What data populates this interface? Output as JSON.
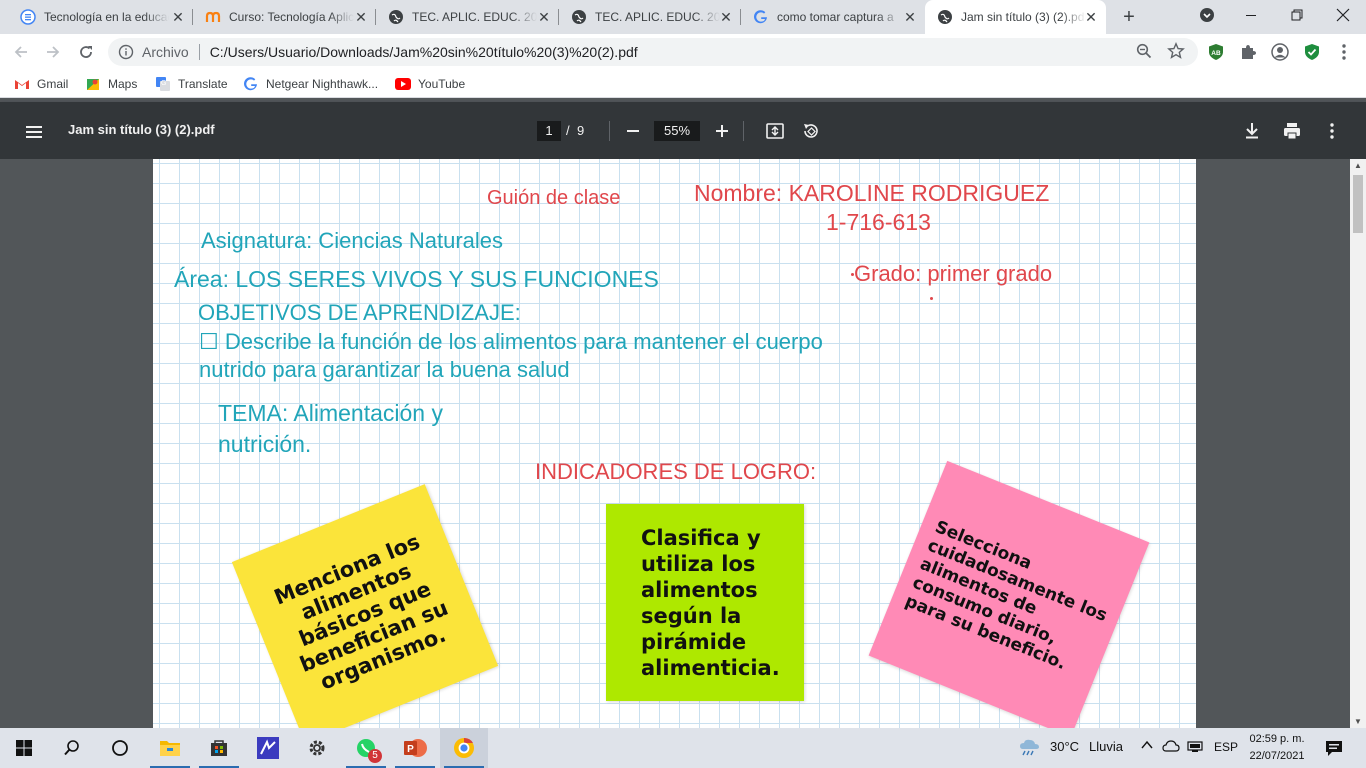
{
  "browser": {
    "tabs": [
      {
        "title": "Tecnología en la educación",
        "icon": "document-list-icon"
      },
      {
        "title": "Curso: Tecnología Aplicada",
        "icon": "moodle-icon"
      },
      {
        "title": "TEC. APLIC. EDUC. 2021",
        "icon": "globe-icon"
      },
      {
        "title": "TEC. APLIC. EDUC. 2021",
        "icon": "globe-icon"
      },
      {
        "title": "como tomar captura a",
        "icon": "google-icon"
      },
      {
        "title": "Jam sin título (3) (2).pdf",
        "icon": "globe-icon"
      }
    ],
    "scheme_label": "Archivo",
    "url": "C:/Users/Usuario/Downloads/Jam%20sin%20título%20(3)%20(2).pdf",
    "extension_ab": "AB"
  },
  "bookmarks": [
    {
      "label": "Gmail",
      "icon": "gmail-icon"
    },
    {
      "label": "Maps",
      "icon": "maps-icon"
    },
    {
      "label": "Translate",
      "icon": "translate-icon"
    },
    {
      "label": "Netgear Nighthawk...",
      "icon": "google-icon"
    },
    {
      "label": "YouTube",
      "icon": "youtube-icon"
    }
  ],
  "pdf": {
    "title": "Jam sin título (3) (2).pdf",
    "current_page": "1",
    "page_sep": "/",
    "total_pages": "9",
    "zoom": "55%"
  },
  "document": {
    "guion": "Guión de clase",
    "nombre": "Nombre: KAROLINE RODRIGUEZ",
    "id_number": "1-716-613",
    "asignatura": "Asignatura: Ciencias Naturales",
    "area": "Área: LOS SERES VIVOS Y SUS FUNCIONES",
    "grado": "Grado: primer grado",
    "objetivos_title": "OBJETIVOS DE APRENDIZAJE:",
    "objetivo_line1": "☐ Describe la función de los alimentos para mantener el cuerpo",
    "objetivo_line2": "nutrido para garantizar la buena salud",
    "tema_line1": "TEMA: Alimentación y",
    "tema_line2": "nutrición.",
    "indicadores": "INDICADORES DE LOGRO:",
    "notes": [
      {
        "lines": [
          "Menciona los",
          "alimentos",
          "básicos que",
          "benefician su",
          "organismo."
        ],
        "color": "#fbe43a"
      },
      {
        "lines": [
          "Clasifica y",
          "utiliza los",
          "alimentos",
          "según la",
          "pirámide",
          "alimenticia."
        ],
        "color": "#aee800"
      },
      {
        "lines": [
          "Selecciona",
          "cuidadosamente los",
          "alimentos de",
          "consumo diario,",
          "para su beneficio."
        ],
        "color": "#ff8ab6"
      }
    ],
    "colors": {
      "teal": "#21a5b9",
      "red": "#e0474c"
    }
  },
  "taskbar": {
    "weather_temp": "30°C",
    "weather_desc": "Lluvia",
    "language": "ESP",
    "time": "02:59 p. m.",
    "date": "22/07/2021",
    "whatsapp_badge": "5"
  }
}
